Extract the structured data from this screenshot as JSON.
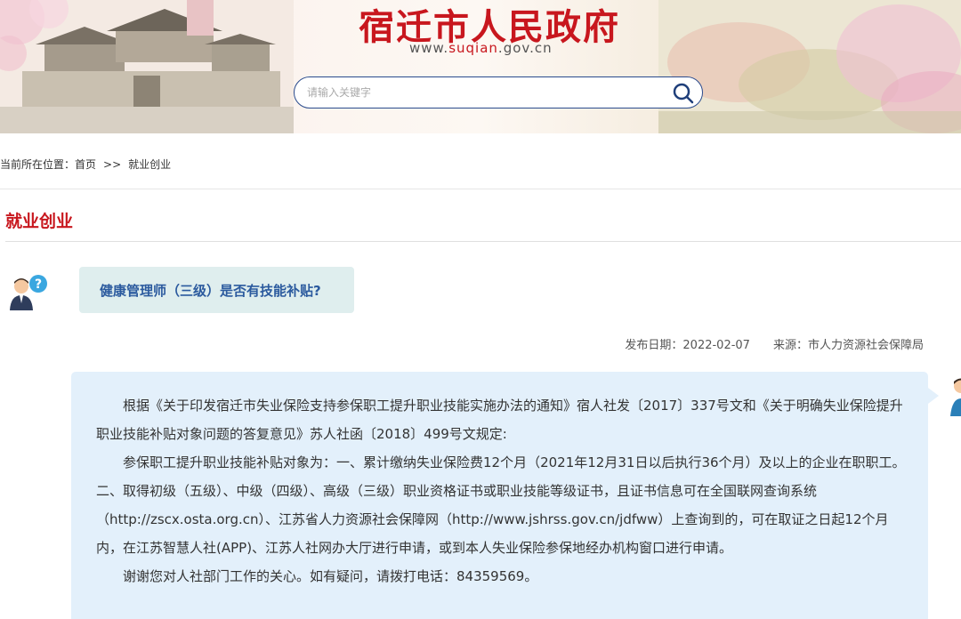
{
  "header": {
    "site_title": "宿迁市人民政府",
    "site_url_prefix": "www.",
    "site_url_highlight": "suqian",
    "site_url_suffix": ".gov.cn",
    "search_placeholder": "请输入关键字",
    "search_icon": "search-icon"
  },
  "breadcrumb": {
    "prefix": "当前所在位置：",
    "home": "首页",
    "separator": ">>",
    "current": "就业创业"
  },
  "section": {
    "title": "就业创业"
  },
  "question": {
    "text": "健康管理师（三级）是否有技能补贴?"
  },
  "meta": {
    "date_label": "发布日期：",
    "date": "2022-02-07",
    "source_label": "来源：",
    "source": "市人力资源社会保障局"
  },
  "answer": {
    "paragraphs": [
      "根据《关于印发宿迁市失业保险支持参保职工提升职业技能实施办法的通知》宿人社发〔2017〕337号文和《关于明确失业保险提升职业技能补贴对象问题的答复意见》苏人社函〔2018〕499号文规定:",
      "参保职工提升职业技能补贴对象为：一、累计缴纳失业保险费12个月（2021年12月31日以后执行36个月）及以上的企业在职职工。二、取得初级（五级）、中级（四级）、高级（三级）职业资格证书或职业技能等级证书，且证书信息可在全国联网查询系统（http://zscx.osta.org.cn）、江苏省人力资源社会保障网（http://www.jshrss.gov.cn/jdfww）上查询到的，可在取证之日起12个月内，在江苏智慧人社(APP)、江苏人社网办大厅进行申请，或到本人失业保险参保地经办机构窗口进行申请。",
      "谢谢您对人社部门工作的关心。如有疑问，请拨打电话：84359569。"
    ]
  },
  "colors": {
    "brand_red": "#c8171e",
    "question_blue": "#2b5a9e",
    "question_bg": "#dfeeee",
    "answer_bg": "#e3f0fb"
  }
}
